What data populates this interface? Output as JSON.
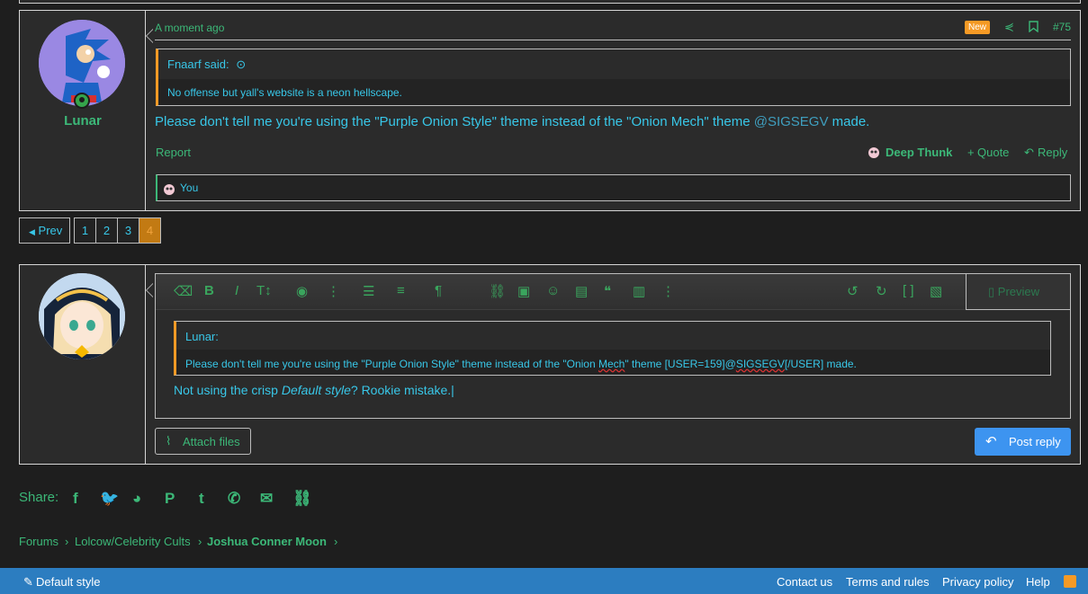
{
  "post": {
    "username": "Lunar",
    "time": "A moment ago",
    "badge": "New",
    "number": "#75",
    "quote_author": "Fnaarf said:",
    "quote_text": "No offense but yall's website is a neon hellscape.",
    "text_before": "Please don't tell me you're using the \"Purple Onion Style\" theme instead of the \"Onion Mech\" theme ",
    "mention": "@SIGSEGV",
    "text_after": " made.",
    "report": "Report",
    "reaction_label": "Deep Thunk",
    "quote_label": "Quote",
    "reply_label": "Reply",
    "reactions_by": "You"
  },
  "pagination": {
    "prev": "Prev",
    "pages": [
      "1",
      "2",
      "3",
      "4"
    ],
    "current": "4"
  },
  "editor": {
    "preview_label": "Preview",
    "quote_author": "Lunar:",
    "quote_pre": "Please don't tell me you're using the \"Purple Onion Style\" theme instead of the \"Onion ",
    "quote_mech": "Mech",
    "quote_mid": "\" theme [USER=159]@",
    "quote_user": "SIGSEGV",
    "quote_end": "[/USER] made.",
    "typed_pre": "Not using the crisp ",
    "typed_em": "Default style",
    "typed_post": "? Rookie mistake.|",
    "attach_label": "Attach files",
    "post_label": "Post reply"
  },
  "share": {
    "label": "Share:",
    "icons": [
      "facebook-icon",
      "twitter-icon",
      "reddit-icon",
      "pinterest-icon",
      "tumblr-icon",
      "whatsapp-icon",
      "email-icon",
      "link-icon"
    ]
  },
  "breadcrumb": [
    "Forums",
    "Lolcow/Celebrity Cults",
    "Joshua Conner Moon"
  ],
  "footer": {
    "style": "Default style",
    "links": [
      "Contact us",
      "Terms and rules",
      "Privacy policy",
      "Help"
    ]
  },
  "colors": {
    "accent_green": "#3cb878",
    "text_cyan": "#38c7e8",
    "orange": "#f59a25",
    "footer_blue": "#2c7dc0",
    "button_blue": "#3d94f0"
  }
}
